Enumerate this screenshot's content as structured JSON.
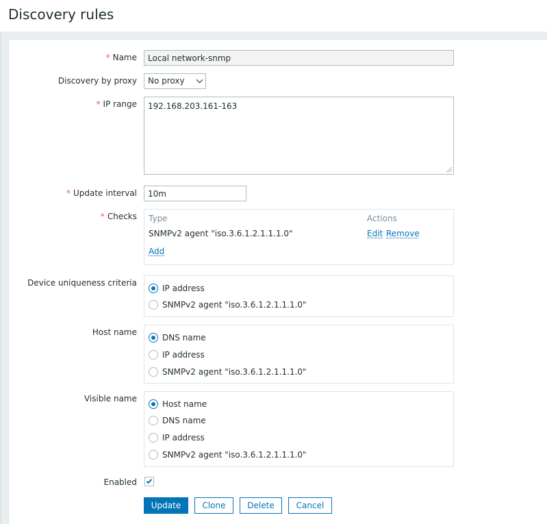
{
  "header": {
    "title": "Discovery rules"
  },
  "form": {
    "name": {
      "label": "Name",
      "value": "Local network-snmp"
    },
    "proxy": {
      "label": "Discovery by proxy",
      "value": "No proxy"
    },
    "ip_range": {
      "label": "IP range",
      "value": "192.168.203.161-163"
    },
    "update_interval": {
      "label": "Update interval",
      "value": "10m"
    },
    "checks": {
      "label": "Checks",
      "col_type": "Type",
      "col_actions": "Actions",
      "rows": [
        {
          "type": "SNMPv2 agent \"iso.3.6.1.2.1.1.1.0\"",
          "edit": "Edit",
          "remove": "Remove"
        }
      ],
      "add": "Add"
    },
    "uniqueness": {
      "label": "Device uniqueness criteria",
      "options": [
        "IP address",
        "SNMPv2 agent \"iso.3.6.1.2.1.1.1.0\""
      ],
      "selected": "IP address"
    },
    "host_name": {
      "label": "Host name",
      "options": [
        "DNS name",
        "IP address",
        "SNMPv2 agent \"iso.3.6.1.2.1.1.1.0\""
      ],
      "selected": "DNS name"
    },
    "visible_name": {
      "label": "Visible name",
      "options": [
        "Host name",
        "DNS name",
        "IP address",
        "SNMPv2 agent \"iso.3.6.1.2.1.1.1.0\""
      ],
      "selected": "Host name"
    },
    "enabled": {
      "label": "Enabled",
      "checked": true
    },
    "buttons": {
      "update": "Update",
      "clone": "Clone",
      "delete": "Delete",
      "cancel": "Cancel"
    }
  },
  "colors": {
    "accent": "#0275b8",
    "required": "#e45959",
    "background": "#ebeef0"
  }
}
